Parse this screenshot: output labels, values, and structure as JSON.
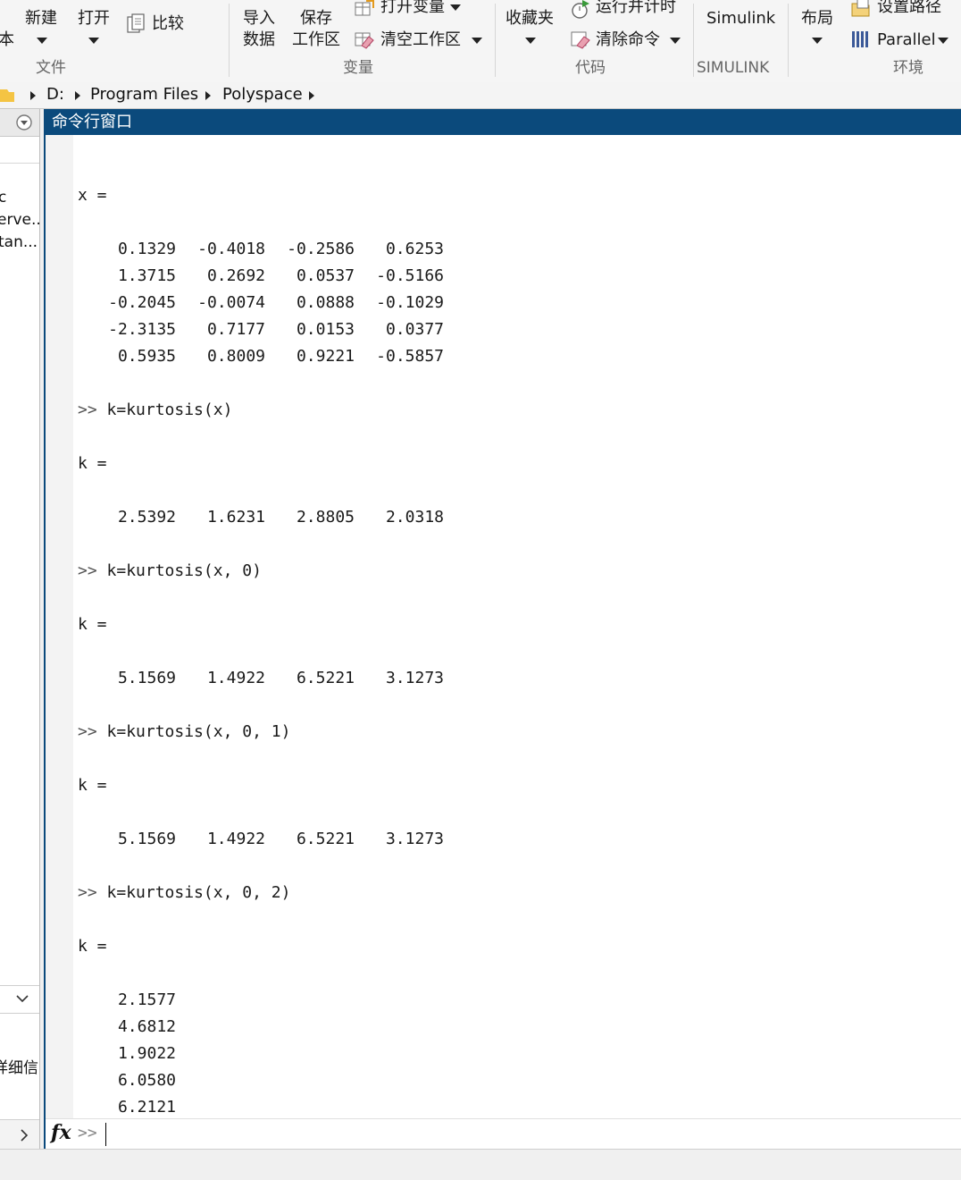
{
  "toolstrip": {
    "file_section": {
      "label": "文件",
      "truncated_left": "本",
      "new_button": "新建",
      "open_button": "打开",
      "compare_button": "比较"
    },
    "variable_section": {
      "label": "变量",
      "import_data_line1": "导入",
      "import_data_line2": "数据",
      "save_workspace_line1": "保存",
      "save_workspace_line2": "工作区",
      "open_variable": "打开变量",
      "clear_workspace": "清空工作区"
    },
    "code_section": {
      "label": "代码",
      "favorites": "收藏夹",
      "run_and_time": "运行并计时",
      "clear_commands": "清除命令"
    },
    "simulink_section": {
      "label": "SIMULINK",
      "simulink_button": "Simulink"
    },
    "environment_section": {
      "label": "环境",
      "layout": "布局",
      "set_path": "设置路径",
      "parallel": "Parallel"
    }
  },
  "address_bar": {
    "crumbs": [
      "D:",
      "Program Files",
      "Polyspace"
    ]
  },
  "left_panel": {
    "items": [
      "c",
      "erve...",
      "tan..."
    ],
    "details_label": "详细信"
  },
  "command_window": {
    "title": "命令行窗口",
    "prompt": ">>",
    "lines": [
      {
        "type": "blank"
      },
      {
        "type": "text",
        "text": "x ="
      },
      {
        "type": "blank"
      },
      {
        "type": "row",
        "cells": [
          "0.1329",
          "-0.4018",
          "-0.2586",
          "0.6253"
        ]
      },
      {
        "type": "row",
        "cells": [
          "1.3715",
          "0.2692",
          "0.0537",
          "-0.5166"
        ]
      },
      {
        "type": "row",
        "cells": [
          "-0.2045",
          "-0.0074",
          "0.0888",
          "-0.1029"
        ]
      },
      {
        "type": "row",
        "cells": [
          "-2.3135",
          "0.7177",
          "0.0153",
          "0.0377"
        ]
      },
      {
        "type": "row",
        "cells": [
          "0.5935",
          "0.8009",
          "0.9221",
          "-0.5857"
        ]
      },
      {
        "type": "blank"
      },
      {
        "type": "cmd",
        "text": "k=kurtosis(x)"
      },
      {
        "type": "blank"
      },
      {
        "type": "text",
        "text": "k ="
      },
      {
        "type": "blank"
      },
      {
        "type": "row",
        "cells": [
          "2.5392",
          "1.6231",
          "2.8805",
          "2.0318"
        ]
      },
      {
        "type": "blank"
      },
      {
        "type": "cmd",
        "text": "k=kurtosis(x, 0)"
      },
      {
        "type": "blank"
      },
      {
        "type": "text",
        "text": "k ="
      },
      {
        "type": "blank"
      },
      {
        "type": "row",
        "cells": [
          "5.1569",
          "1.4922",
          "6.5221",
          "3.1273"
        ]
      },
      {
        "type": "blank"
      },
      {
        "type": "cmd",
        "text": "k=kurtosis(x, 0, 1)"
      },
      {
        "type": "blank"
      },
      {
        "type": "text",
        "text": "k ="
      },
      {
        "type": "blank"
      },
      {
        "type": "row",
        "cells": [
          "5.1569",
          "1.4922",
          "6.5221",
          "3.1273"
        ]
      },
      {
        "type": "blank"
      },
      {
        "type": "cmd",
        "text": "k=kurtosis(x, 0, 2)"
      },
      {
        "type": "blank"
      },
      {
        "type": "text",
        "text": "k ="
      },
      {
        "type": "blank"
      },
      {
        "type": "row",
        "cells": [
          "2.1577"
        ]
      },
      {
        "type": "row",
        "cells": [
          "4.6812"
        ]
      },
      {
        "type": "row",
        "cells": [
          "1.9022"
        ]
      },
      {
        "type": "row",
        "cells": [
          "6.0580"
        ]
      },
      {
        "type": "row",
        "cells": [
          "6.2121"
        ]
      }
    ]
  },
  "colors": {
    "title_bar": "#0b4a7c",
    "toolstrip_bg": "#f5f5f5",
    "console_text": "#1a1a1a"
  }
}
